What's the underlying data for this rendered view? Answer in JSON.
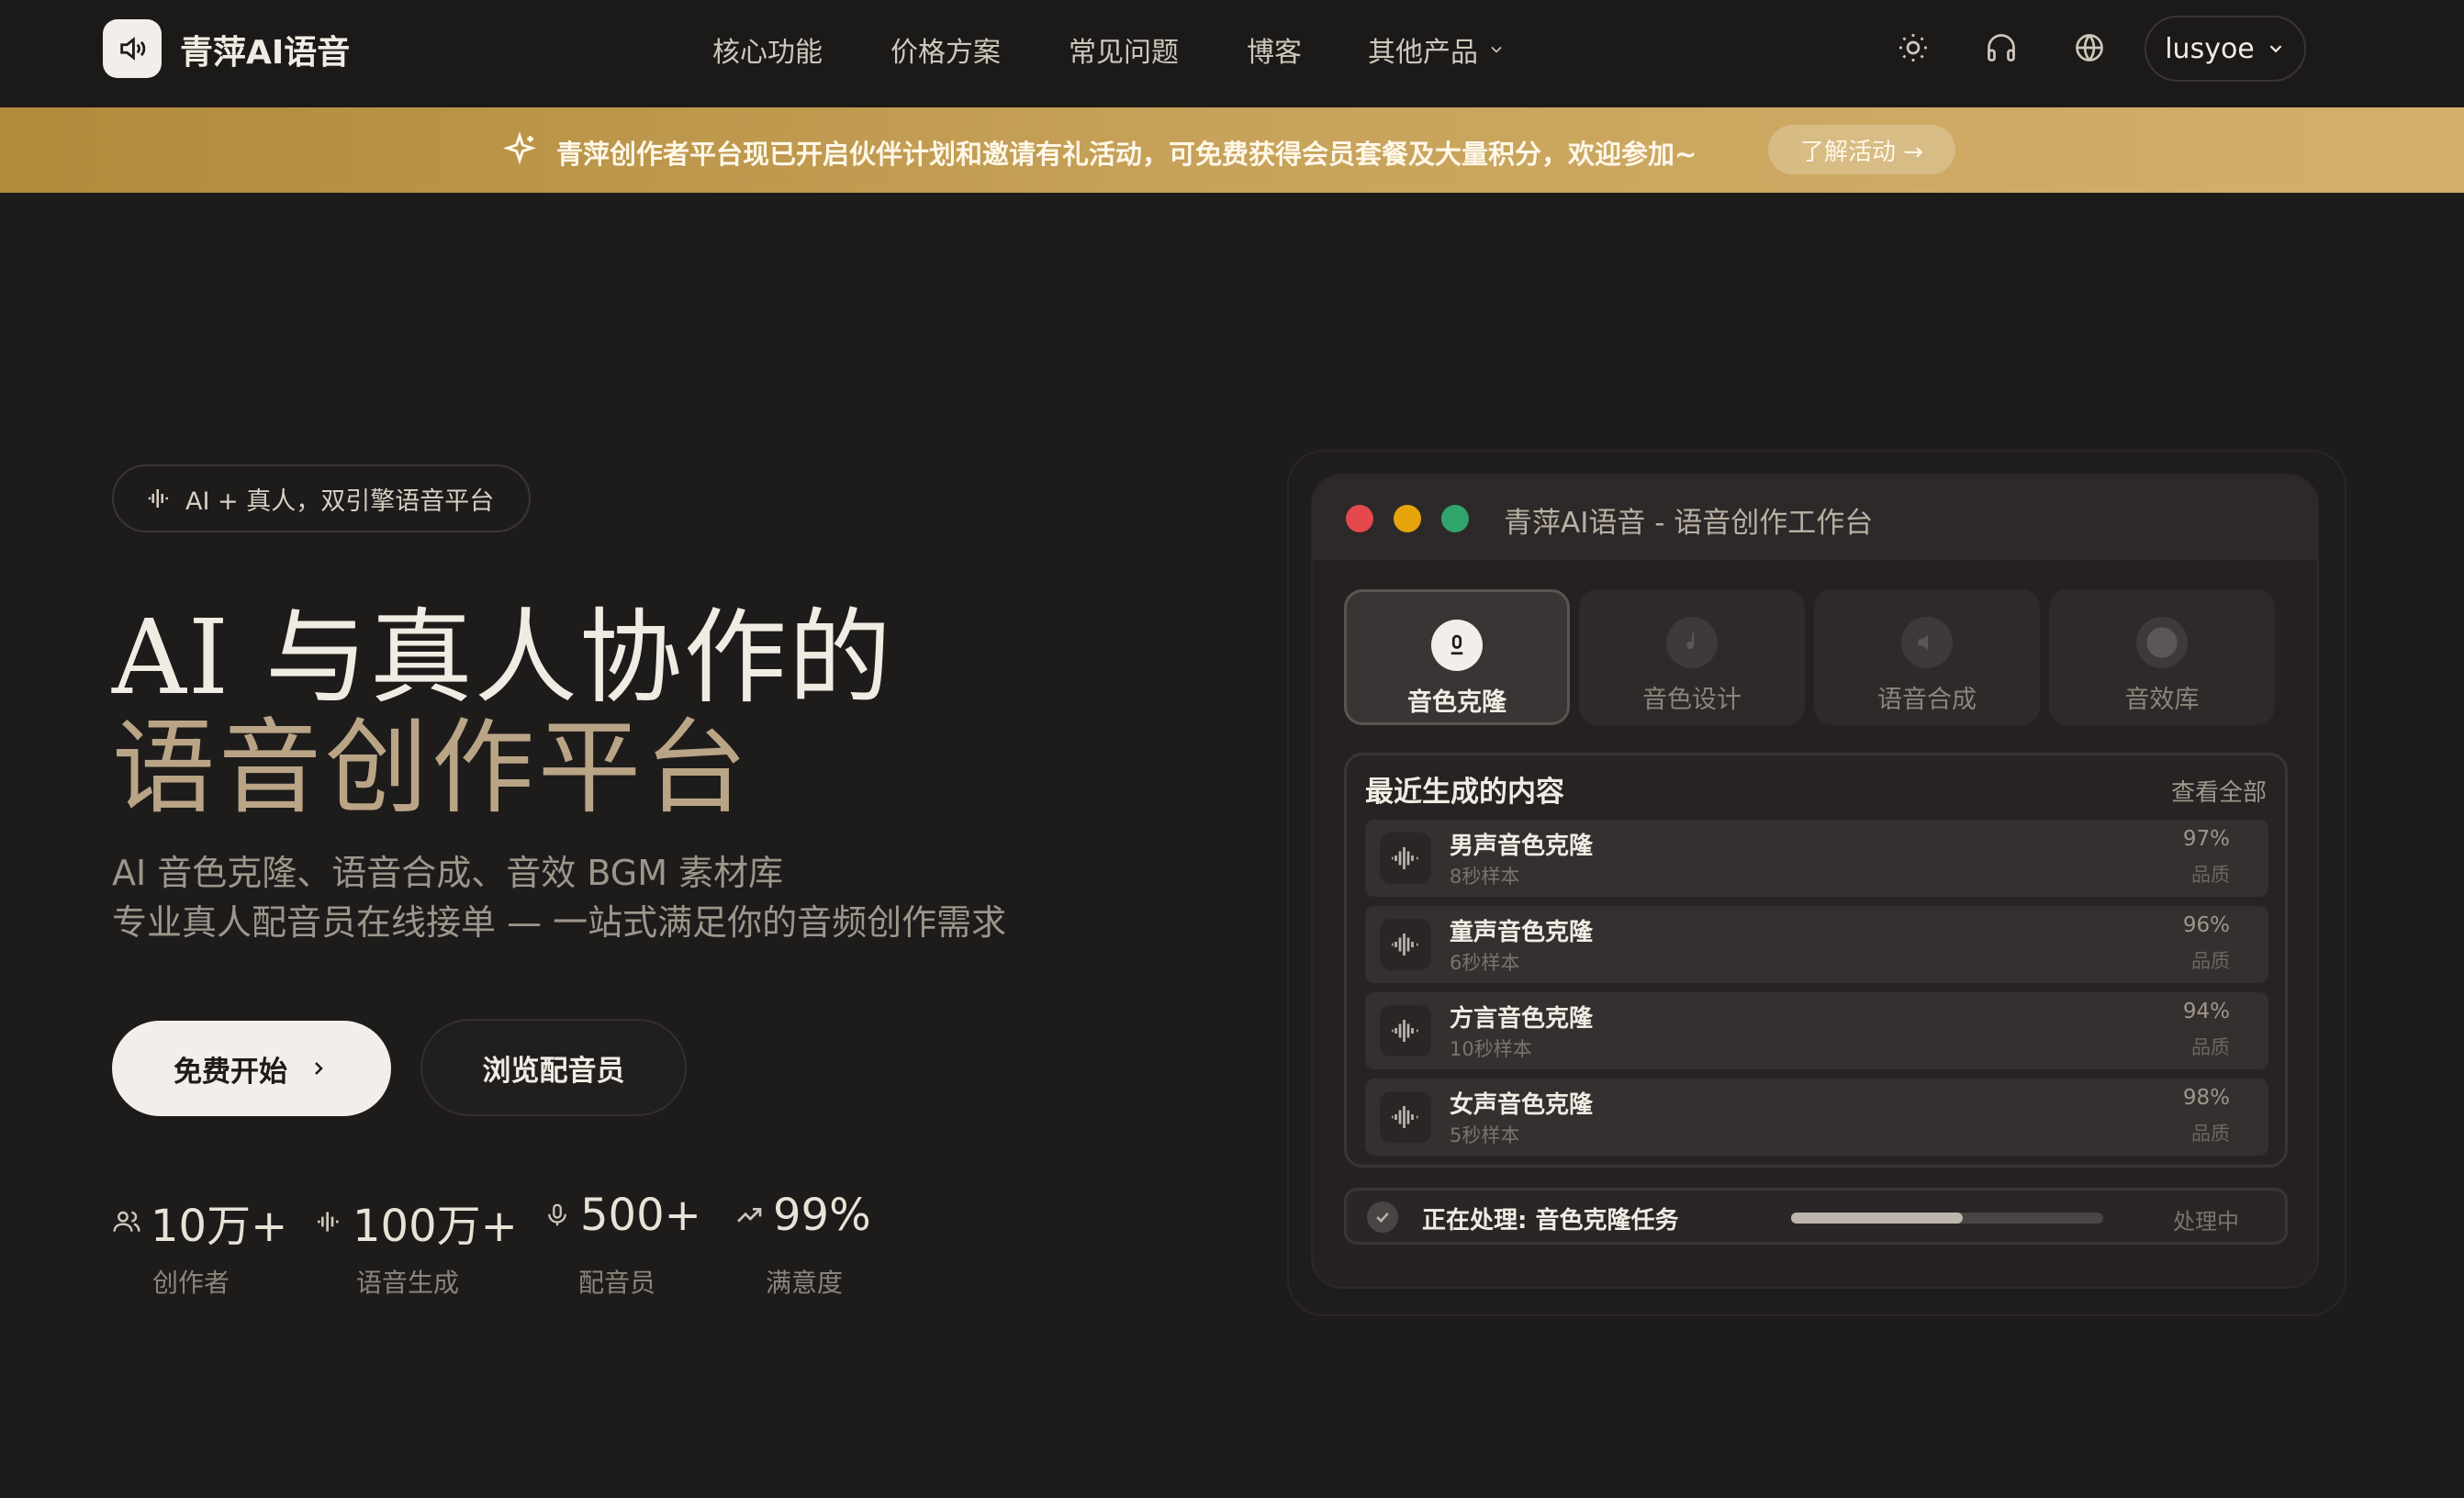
{
  "header": {
    "logo_text": "青萍AI语音",
    "nav": [
      "核心功能",
      "价格方案",
      "常见问题",
      "博客",
      "其他产品"
    ],
    "user": "lusyoe"
  },
  "banner": {
    "text": "青萍创作者平台现已开启伙伴计划和邀请有礼活动，可免费获得会员套餐及大量积分，欢迎参加~",
    "button": "了解活动 →"
  },
  "hero": {
    "badge": "AI + 真人，双引擎语音平台",
    "title_line1": "AI 与真人协作的",
    "title_line2": "语音创作平台",
    "subtitle_line1": "AI 音色克隆、语音合成、音效 BGM 素材库",
    "subtitle_line2": "专业真人配音员在线接单 — 一站式满足你的音频创作需求",
    "primary_button": "免费开始",
    "secondary_button": "浏览配音员"
  },
  "stats": [
    {
      "value": "10万+",
      "label": "创作者",
      "icon": "users-icon"
    },
    {
      "value": "100万+",
      "label": "语音生成",
      "icon": "waveform-icon"
    },
    {
      "value": "500+",
      "label": "配音员",
      "icon": "mic-icon"
    },
    {
      "value": "99%",
      "label": "满意度",
      "icon": "trend-icon"
    }
  ],
  "workbench": {
    "title": "青萍AI语音 - 语音创作工作台",
    "tabs": [
      "音色克隆",
      "音色设计",
      "语音合成",
      "音效库"
    ],
    "active_tab": 0,
    "recent_title": "最近生成的内容",
    "view_all": "查看全部",
    "items": [
      {
        "name": "男声音色克隆",
        "sample": "8秒样本",
        "quality": "97%",
        "quality_label": "品质"
      },
      {
        "name": "童声音色克隆",
        "sample": "6秒样本",
        "quality": "96%",
        "quality_label": "品质"
      },
      {
        "name": "方言音色克隆",
        "sample": "10秒样本",
        "quality": "94%",
        "quality_label": "品质"
      },
      {
        "name": "女声音色克隆",
        "sample": "5秒样本",
        "quality": "98%",
        "quality_label": "品质"
      }
    ],
    "processing_text": "正在处理: 音色克隆任务",
    "processing_status": "处理中",
    "processing_progress": 0.55
  },
  "colors": {
    "background": "#1e1b1b",
    "banner_gold": "#c7a25a",
    "accent_light": "#f2efea",
    "title_gold": "#b9a586",
    "dot_red": "#e5484d",
    "dot_yellow": "#e5a50a",
    "dot_green": "#30a46c"
  }
}
